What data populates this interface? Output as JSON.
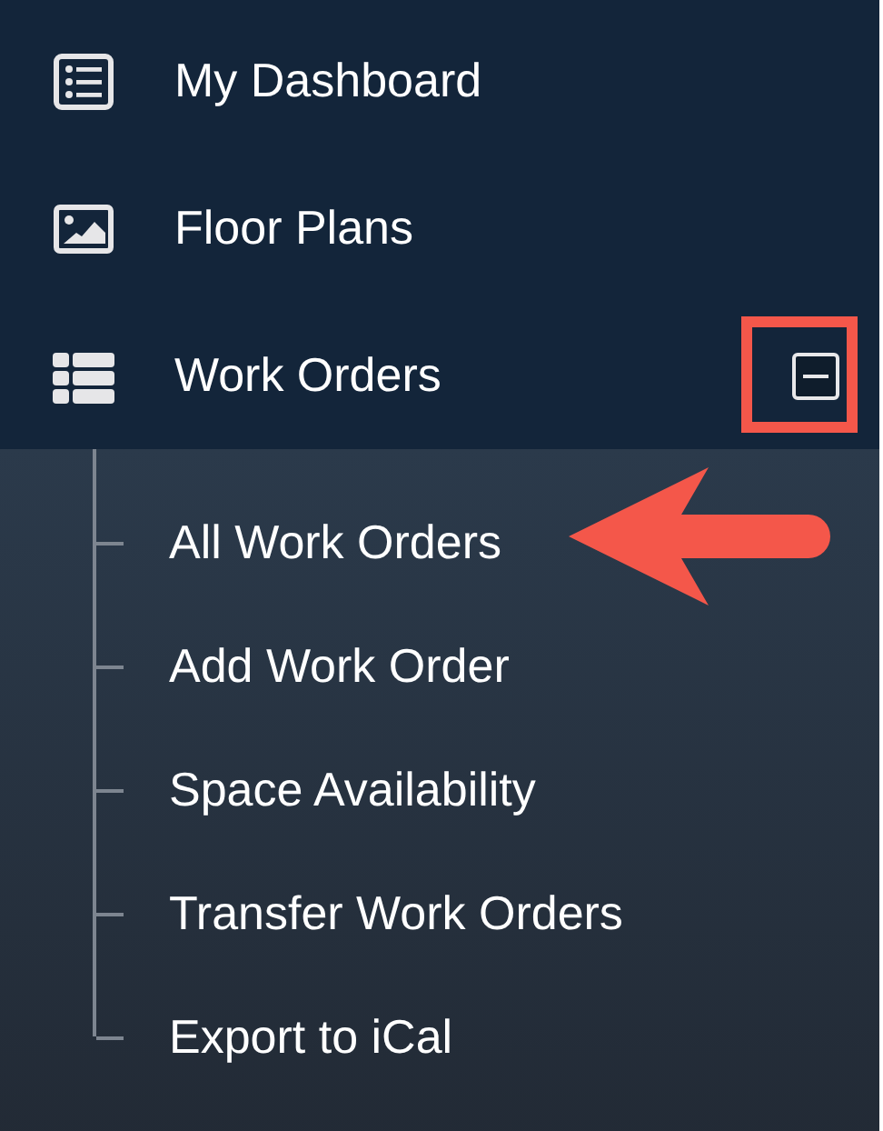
{
  "menu": [
    {
      "kind": "dashboard",
      "label": "My Dashboard"
    },
    {
      "kind": "image",
      "label": "Floor Plans"
    },
    {
      "kind": "list",
      "label": "Work Orders",
      "expanded": true,
      "toggle_highlighted": true,
      "children": [
        {
          "label": "All Work Orders",
          "arrow": true
        },
        {
          "label": "Add Work Order",
          "arrow": false
        },
        {
          "label": "Space Availability",
          "arrow": false
        },
        {
          "label": "Transfer Work Orders",
          "arrow": false
        },
        {
          "label": "Export to iCal",
          "arrow": false
        }
      ]
    }
  ]
}
